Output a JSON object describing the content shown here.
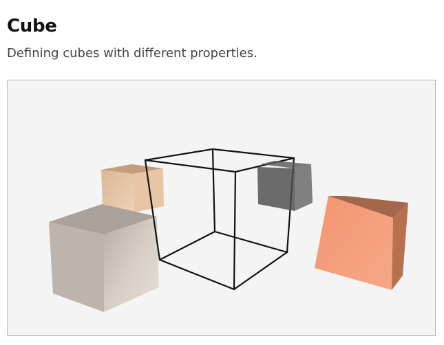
{
  "header": {
    "title": "Cube",
    "description": "Defining cubes with different properties."
  },
  "scene": {
    "background_color": "#f4f4f4",
    "border_color": "#b8b8b8",
    "cubes": [
      {
        "name": "tan-cube",
        "style": "solid",
        "color": "#e3c2a2"
      },
      {
        "name": "beige-cube",
        "style": "solid",
        "color": "#d8d0c8"
      },
      {
        "name": "wireframe-cube",
        "style": "wireframe",
        "color": "#111111"
      },
      {
        "name": "dark-gray-cube",
        "style": "semi-transparent",
        "color": "#4f4f4f"
      },
      {
        "name": "salmon-cube",
        "style": "solid",
        "color": "#f39a76"
      }
    ]
  }
}
